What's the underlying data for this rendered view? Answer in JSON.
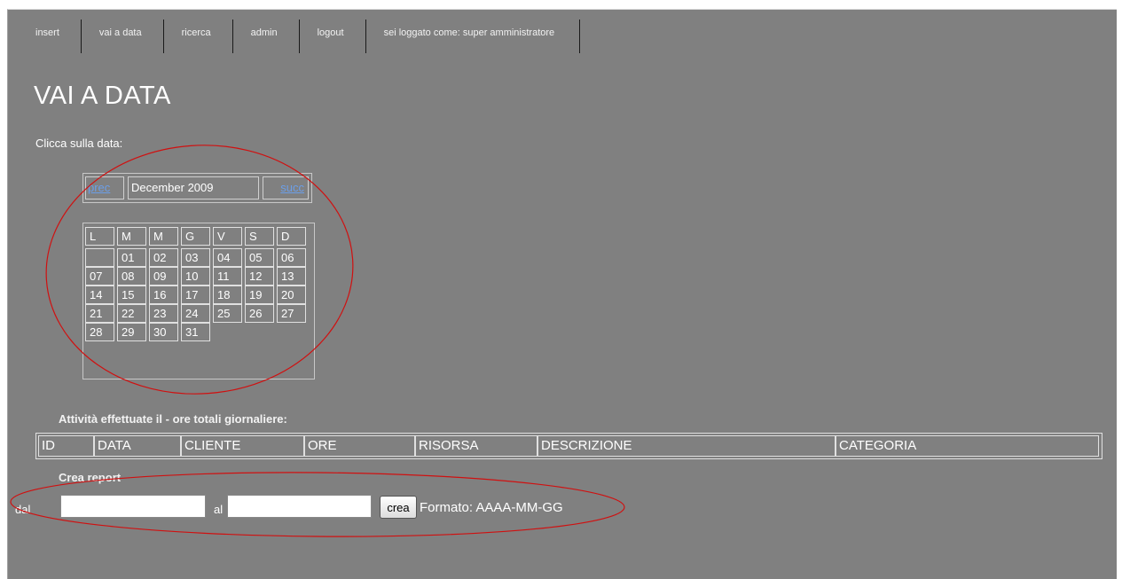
{
  "nav": {
    "items": [
      "insert",
      "vai a data",
      "ricerca",
      "admin",
      "logout"
    ],
    "user_label": "sei loggato come: super amministratore"
  },
  "page_title": "VAI A DATA",
  "instruction": "Clicca sulla data:",
  "calendar": {
    "prev_label": "prec",
    "month_label": "December 2009",
    "next_label": "succ",
    "weekdays": [
      "L",
      "M",
      "M",
      "G",
      "V",
      "S",
      "D"
    ],
    "weeks": [
      [
        "",
        "01",
        "02",
        "03",
        "04",
        "05",
        "06"
      ],
      [
        "07",
        "08",
        "09",
        "10",
        "11",
        "12",
        "13"
      ],
      [
        "14",
        "15",
        "16",
        "17",
        "18",
        "19",
        "20"
      ],
      [
        "21",
        "22",
        "23",
        "24",
        "25",
        "26",
        "27"
      ],
      [
        "28",
        "29",
        "30",
        "31"
      ]
    ]
  },
  "activities": {
    "heading": "Attività effettuate il - ore totali giornaliere:",
    "columns": [
      "ID",
      "DATA",
      "CLIENTE",
      "ORE",
      "RISORSA",
      "DESCRIZIONE",
      "CATEGORIA"
    ]
  },
  "report": {
    "heading": "Crea report",
    "from_label": "dal",
    "from_value": "",
    "to_label": "al",
    "to_value": "",
    "button_label": "crea",
    "format_hint": "Formato: AAAA-MM-GG"
  },
  "colors": {
    "background": "#808080",
    "link": "#6b9ee8",
    "annotation": "#d01010"
  }
}
